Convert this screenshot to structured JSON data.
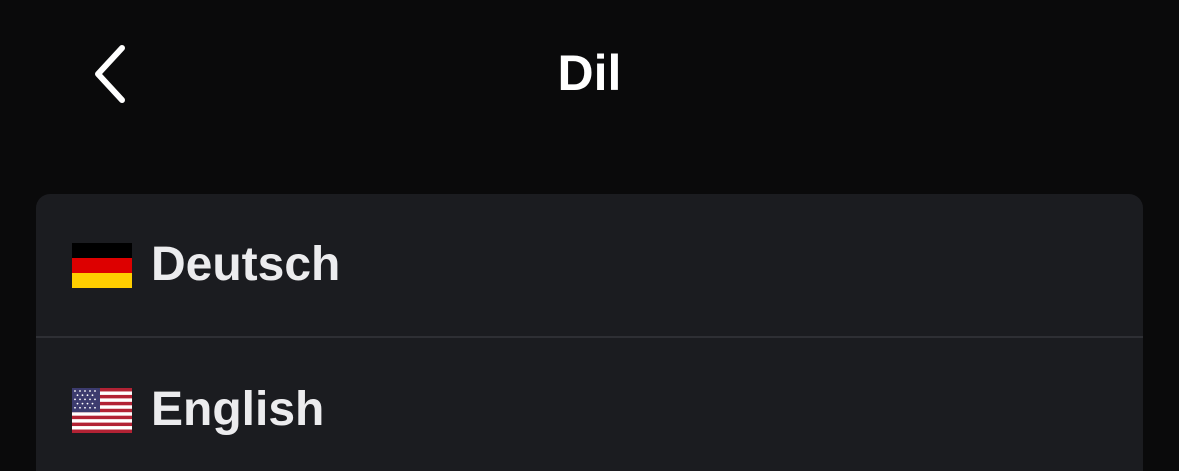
{
  "header": {
    "back_icon": "chevron-left-icon",
    "title": "Dil"
  },
  "languages": [
    {
      "label": "Deutsch",
      "flag_icon": "germany-flag-icon"
    },
    {
      "label": "English",
      "flag_icon": "us-flag-icon"
    }
  ],
  "colors": {
    "background": "#0a0a0b",
    "card": "#1b1c20",
    "divider": "#2e2f34",
    "text": "#ececee",
    "title": "#ffffff"
  }
}
